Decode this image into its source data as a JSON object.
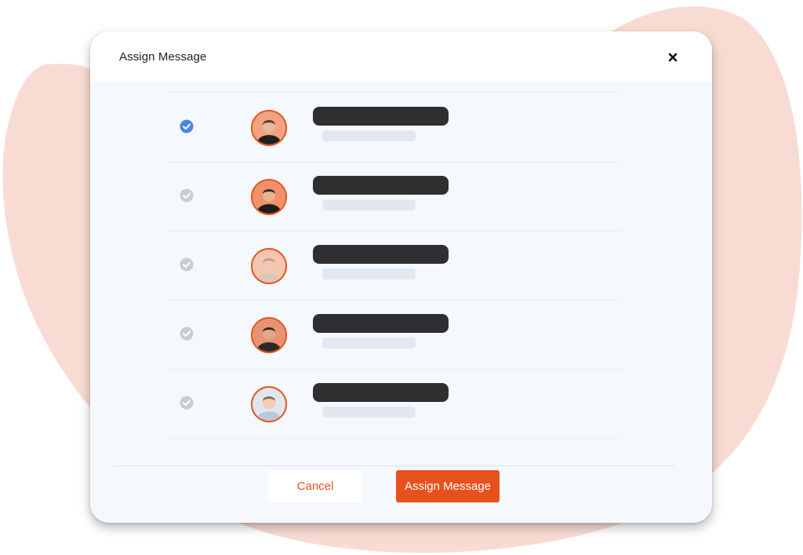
{
  "modal": {
    "title": "Assign Message",
    "close_icon": "close-icon"
  },
  "colors": {
    "accent": "#e8501c",
    "check_selected": "#4a86e0",
    "check_unselected": "#c9ccd1",
    "blob": "#f8dcd3",
    "modal_bg": "#f5f8fd",
    "placeholder_dark": "#2f2f32",
    "placeholder_light": "#e3e8f0"
  },
  "assignees": [
    {
      "selected": true,
      "avatar_icon": "avatar-icon"
    },
    {
      "selected": false,
      "avatar_icon": "avatar-icon"
    },
    {
      "selected": false,
      "avatar_icon": "avatar-icon"
    },
    {
      "selected": false,
      "avatar_icon": "avatar-icon"
    },
    {
      "selected": false,
      "avatar_icon": "avatar-icon"
    }
  ],
  "footer": {
    "cancel_label": "Cancel",
    "assign_label": "Assign Message"
  }
}
